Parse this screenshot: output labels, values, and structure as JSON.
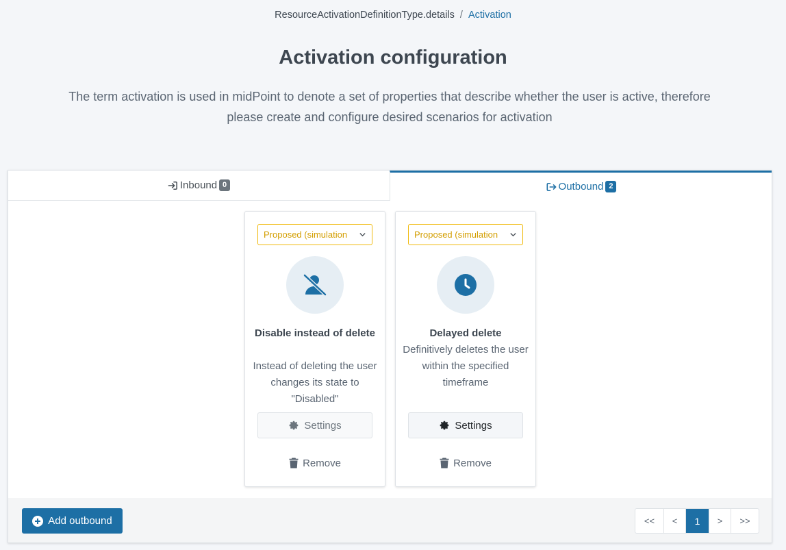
{
  "breadcrumb": {
    "parent": "ResourceActivationDefinitionType.details",
    "separator": "/",
    "current": "Activation"
  },
  "header": {
    "title": "Activation configuration",
    "description": "The term activation is used in midPoint to denote a set of properties that describe whether the user is active, therefore please create and configure desired scenarios for activation"
  },
  "tabs": [
    {
      "label": "Inbound",
      "count": "0",
      "icon": "sign-in-icon",
      "active": false
    },
    {
      "label": "Outbound",
      "count": "2",
      "icon": "sign-out-icon",
      "active": true
    }
  ],
  "cards": [
    {
      "lifecycle": "Proposed (simulation",
      "icon": "user-slash-icon",
      "title": "Disable instead of delete",
      "description": "Instead of deleting the user changes its state to \"Disabled\"",
      "settings_label": "Settings",
      "remove_label": "Remove"
    },
    {
      "lifecycle": "Proposed (simulation",
      "icon": "clock-icon",
      "title": "Delayed delete",
      "description": "Definitively deletes the user within the specified timeframe",
      "settings_label": "Settings",
      "remove_label": "Remove"
    }
  ],
  "footer": {
    "add_label": "Add outbound",
    "pagination": {
      "first": "<<",
      "prev": "<",
      "current": "1",
      "next": ">",
      "last": ">>"
    }
  },
  "colors": {
    "accent": "#1d6fa5",
    "warning": "#f0b90b",
    "background": "#f4f6f9"
  }
}
